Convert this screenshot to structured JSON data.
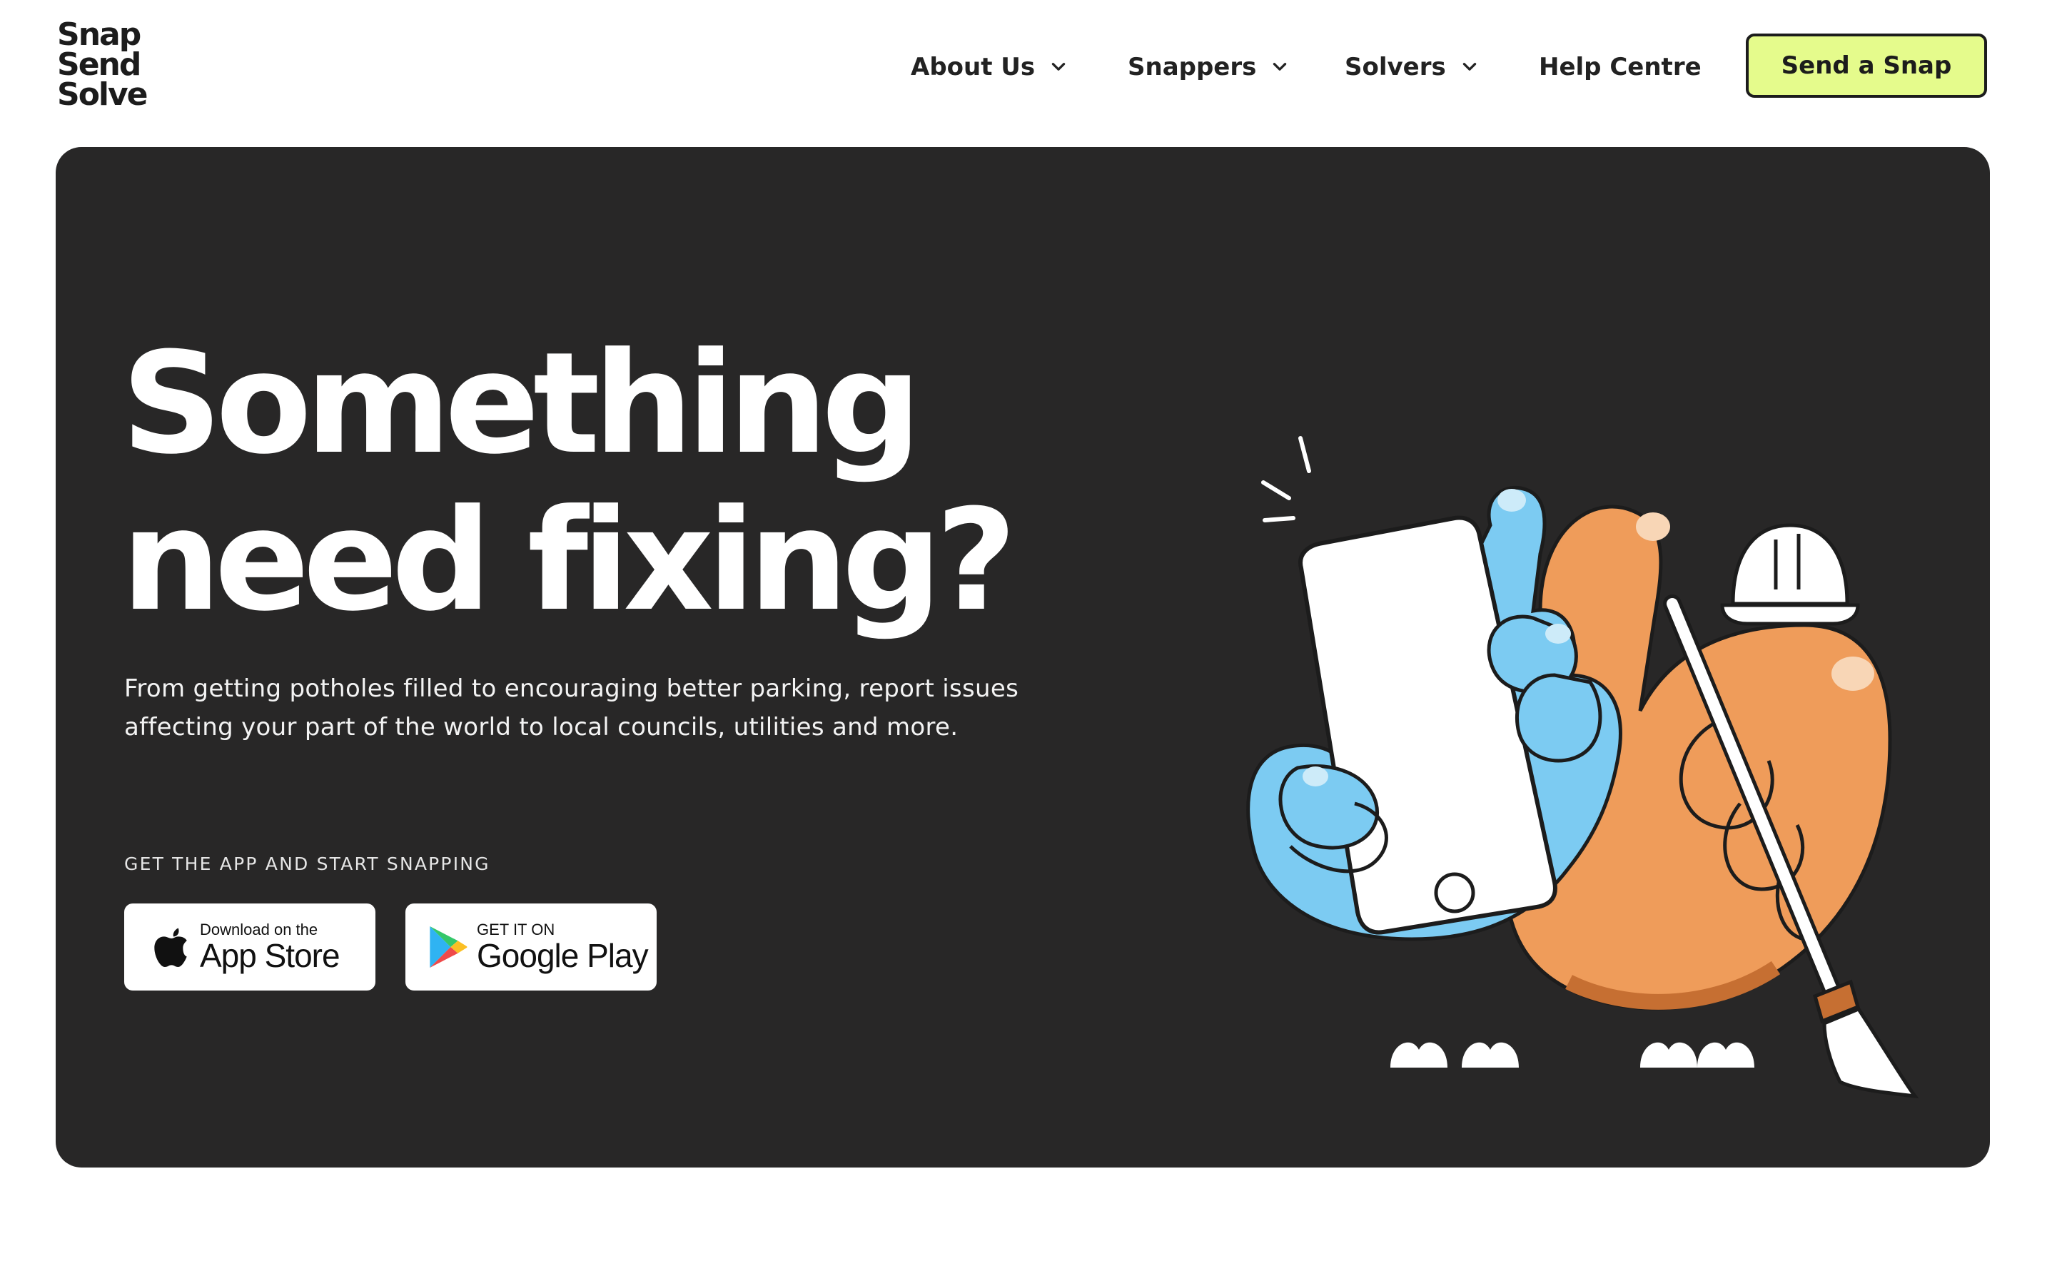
{
  "logo": {
    "lines": [
      "Snap",
      "Send",
      "Solve"
    ]
  },
  "nav": {
    "items": [
      {
        "label": "About Us"
      },
      {
        "label": "Snappers"
      },
      {
        "label": "Solvers"
      },
      {
        "label": "Help Centre"
      }
    ],
    "cta_label": "Send a Snap"
  },
  "hero": {
    "headline_line1": "Something",
    "headline_line2": "need fixing?",
    "description_line1": "From getting potholes filled to encouraging better parking, report issues",
    "description_line2": "affecting your part of the world to local councils, utilities and more.",
    "get_app_label": "GET THE APP AND START SNAPPING",
    "app_store": {
      "small": "Download on the",
      "big": "App Store",
      "icon": "apple-icon"
    },
    "google_play": {
      "small": "GET IT ON",
      "big": "Google Play",
      "icon": "google-play-icon"
    }
  },
  "colors": {
    "hero_bg": "#282727",
    "cta_bg": "#e5fb8c",
    "hand_blue": "#7ccbf2",
    "hand_orange": "#ef9c5a"
  }
}
